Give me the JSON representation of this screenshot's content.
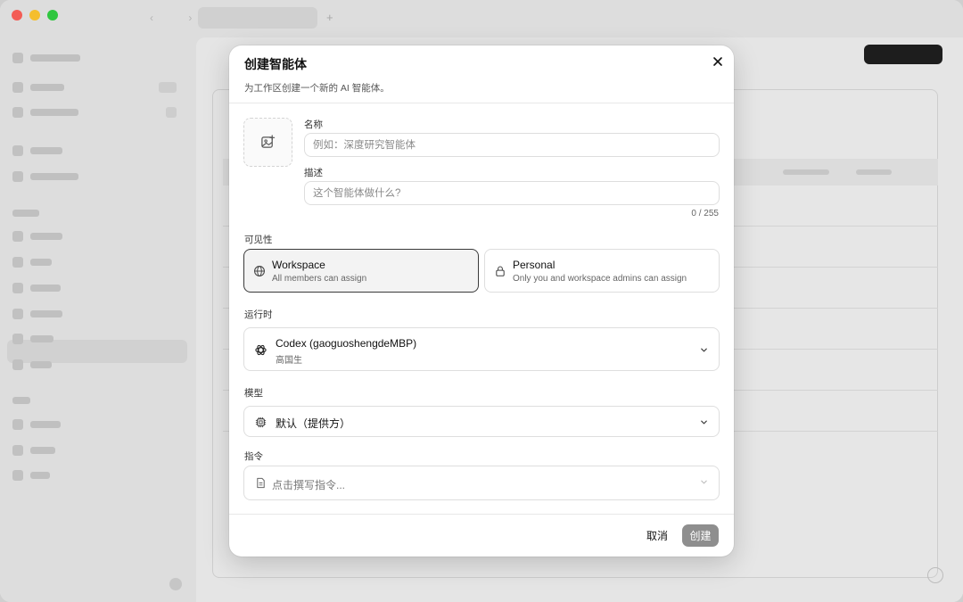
{
  "modal": {
    "title": "创建智能体",
    "subtitle": "为工作区创建一个新的 AI 智能体。",
    "name_label": "名称",
    "name_placeholder": "例如：深度研究智能体",
    "name_value": "",
    "description_label": "描述",
    "description_placeholder": "这个智能体做什么?",
    "description_value": "",
    "char_counter": "0 / 255",
    "visibility": {
      "label": "可见性",
      "selected": "Workspace",
      "options": [
        {
          "title": "Workspace",
          "description": "All members can assign",
          "icon": "globe-icon"
        },
        {
          "title": "Personal",
          "description": "Only you and workspace admins can assign",
          "icon": "lock-icon"
        }
      ]
    },
    "runtime": {
      "label": "运行时",
      "selected_name": "Codex (gaoguoshengdeMBP)",
      "selected_owner": "高国生",
      "icon": "openai-icon"
    },
    "model": {
      "label": "模型",
      "selected": "默认（提供方）",
      "icon": "chip-icon"
    },
    "instructions": {
      "label": "指令",
      "placeholder": "点击撰写指令...",
      "icon": "document-icon"
    },
    "cancel_label": "取消",
    "create_label": "创建"
  },
  "colors": {
    "create_button": "#8e8e8e",
    "selected_card_border": "#3a3a3a",
    "window_background": "#e9e9e9"
  }
}
